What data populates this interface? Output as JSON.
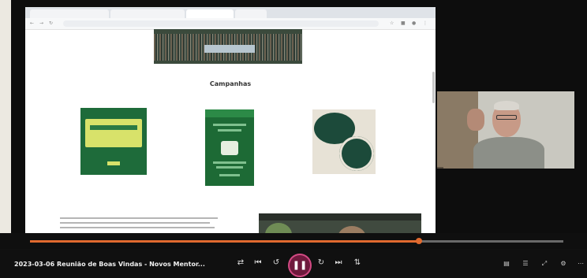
{
  "browser": {
    "tabs": [
      "",
      "",
      "",
      ""
    ],
    "url": "",
    "banner_caption": "",
    "section_title": "Campanhas",
    "cards": [
      {
        "caption": ""
      },
      {
        "caption": ""
      },
      {
        "caption": ""
      }
    ],
    "mini_player_title": ""
  },
  "webcam": {
    "participant_name": ""
  },
  "player": {
    "video_title": "2023-03-06 Reunião de Boas Vindas - Novos Mentor...",
    "time_current": "",
    "time_total": "",
    "progress": 0.73,
    "accent_color": "#e06a2f",
    "play_ring_color": "#d24a83"
  },
  "controls": {
    "left_icons": [
      "shuffle-icon",
      "previous-icon",
      "rewind-icon",
      "pause-icon",
      "forward-icon",
      "next-icon",
      "repeat-icon"
    ],
    "right_icons": [
      "subtitles-icon",
      "playlist-icon",
      "fullscreen-icon",
      "settings-icon",
      "more-icon"
    ]
  }
}
